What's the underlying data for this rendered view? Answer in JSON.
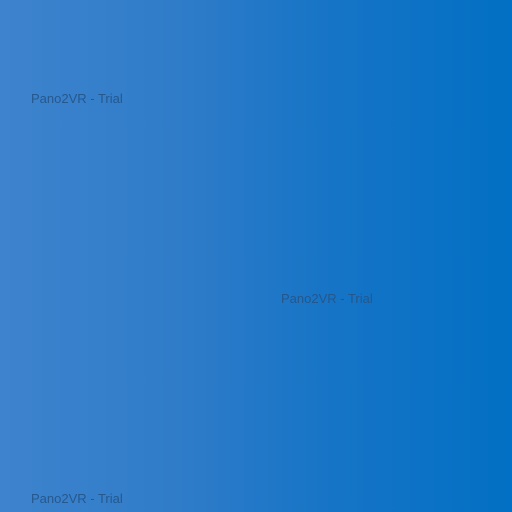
{
  "background": {
    "gradient_start": "#3e83cd",
    "gradient_end": "#0270c4"
  },
  "watermarks": [
    {
      "text": "Pano2VR - Trial"
    },
    {
      "text": "Pano2VR - Trial"
    },
    {
      "text": "Pano2VR - Trial"
    }
  ],
  "colors": {
    "watermark_text": "#25568a"
  }
}
